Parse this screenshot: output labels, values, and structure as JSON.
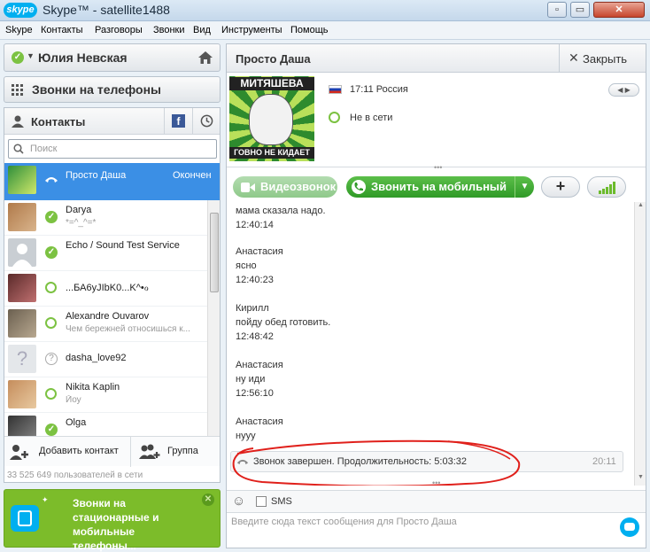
{
  "window": {
    "logo": "skype",
    "title": "Skype™ - satellite1488",
    "min": "▫",
    "restore": "▭",
    "close": "✕"
  },
  "menu": [
    "Skype",
    "Контакты",
    "Разговоры",
    "Звонки",
    "Вид",
    "Инструменты",
    "Помощь"
  ],
  "user": {
    "name": "Юлия Невская",
    "status_icon": "check-icon",
    "home_icon": "home-icon"
  },
  "phone_calls": {
    "label": "Звонки на телефоны"
  },
  "contacts_header": {
    "title": "Контакты"
  },
  "search": {
    "placeholder": "Поиск"
  },
  "contacts": [
    {
      "name": "Просто Даша",
      "note": "Окончен",
      "selected": true
    },
    {
      "name": "Darya",
      "mood": "*=^_^=*"
    },
    {
      "name": "Echo / Sound Test Service",
      "mood": ""
    },
    {
      "name": "...БА6yJIbK0...K^•ℴ",
      "mood": ""
    },
    {
      "name": "Alexandre Ouvarov",
      "mood": "Чем бережней относишься к..."
    },
    {
      "name": "dasha_love92",
      "mood": ""
    },
    {
      "name": "Nikita Kaplin",
      "mood": "Йоу"
    },
    {
      "name": "Olga",
      "mood": ""
    }
  ],
  "contact_actions": {
    "add": "Добавить контакт",
    "group": "Группа"
  },
  "online_count": "33 525 649 пользователей в сети",
  "promo": {
    "text": "Звонки на стационарные и мобильные телефоны..."
  },
  "chat": {
    "name": "Просто Даша",
    "close_label": "Закрыть",
    "avatar_top": "МИТЯШЕВА",
    "avatar_bottom": "ГОВНО НЕ КИДАЕТ",
    "time_location": "17:11 Россия",
    "status": "Не в сети"
  },
  "toolbar": {
    "video": "Видеозвонок",
    "call": "Звонить на мобильный",
    "add": "+"
  },
  "messages": [
    {
      "lines": [
        "мама сказала надо.",
        "12:40:14"
      ]
    },
    {
      "lines": [
        "Анастасия",
        "ясно",
        "12:40:23"
      ]
    },
    {
      "lines": [
        "Кирилл",
        "пойду обед готовить.",
        "12:48:42"
      ]
    },
    {
      "lines": [
        "Анастасия",
        "ну иди",
        "12:56:10"
      ]
    },
    {
      "lines": [
        "Анастасия",
        "нууу"
      ]
    }
  ],
  "call_end": {
    "text": "Звонок завершен. Продолжительность: 5:03:32",
    "time": "20:11"
  },
  "compose": {
    "sms_label": "SMS",
    "placeholder": "Введите сюда текст сообщения для Просто Даша"
  },
  "colors": {
    "accent": "#00aff0",
    "green": "#6cbb2c",
    "selected": "#3b8fe5"
  }
}
